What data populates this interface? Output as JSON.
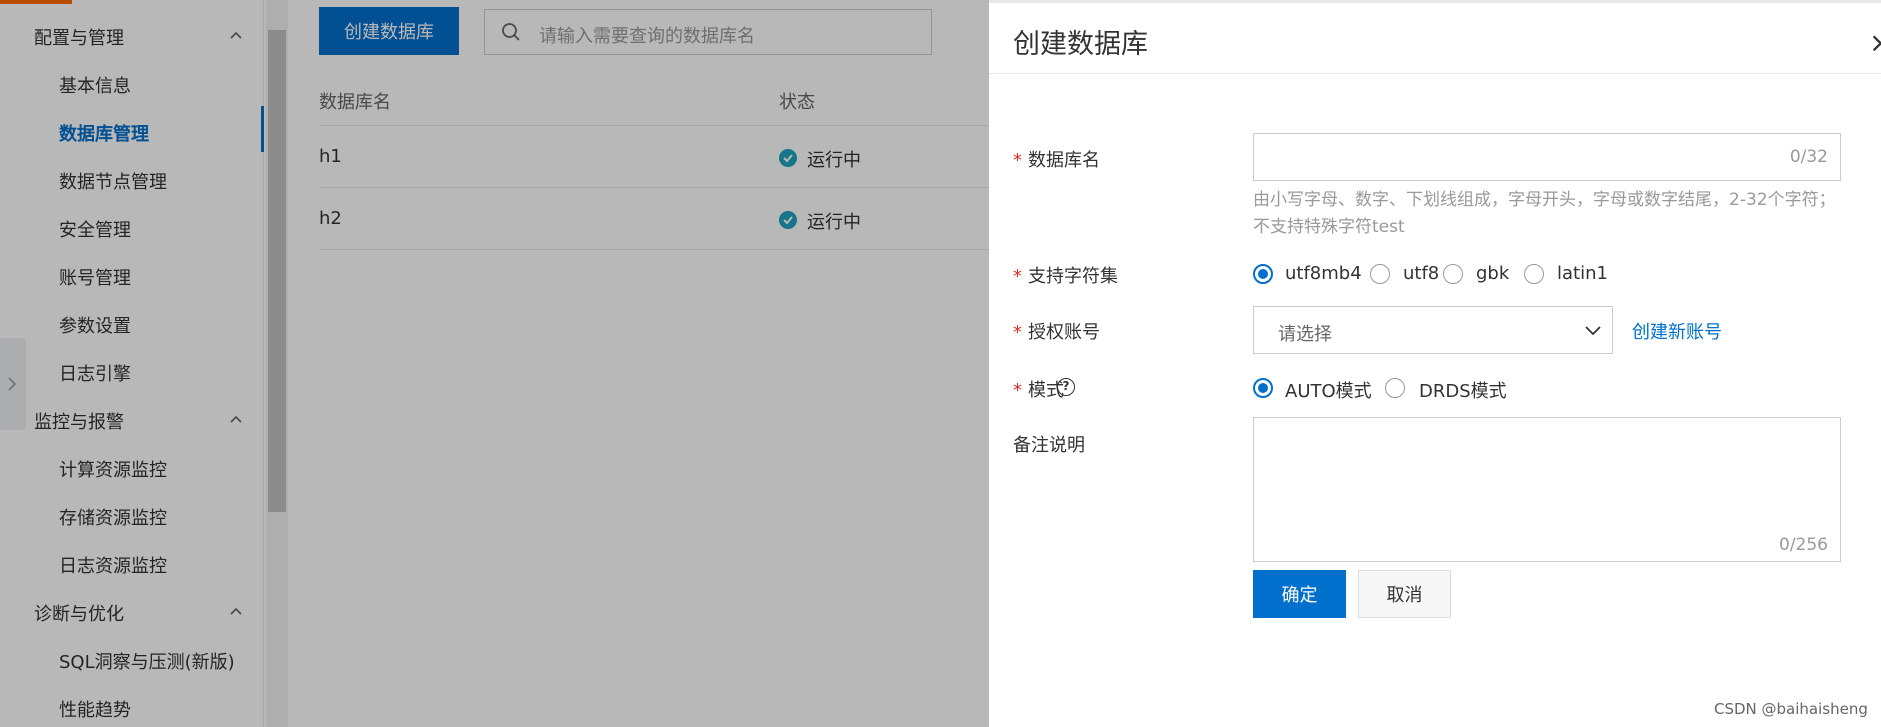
{
  "sidebar": {
    "groups": [
      {
        "label": "配置与管理"
      },
      {
        "label": "监控与报警"
      },
      {
        "label": "诊断与优化"
      }
    ],
    "items": [
      {
        "label": "基本信息"
      },
      {
        "label": "数据库管理"
      },
      {
        "label": "数据节点管理"
      },
      {
        "label": "安全管理"
      },
      {
        "label": "账号管理"
      },
      {
        "label": "参数设置"
      },
      {
        "label": "日志引擎"
      },
      {
        "label": "计算资源监控"
      },
      {
        "label": "存储资源监控"
      },
      {
        "label": "日志资源监控"
      },
      {
        "label": "SQL洞察与压测(新版)"
      },
      {
        "label": "性能趋势"
      }
    ]
  },
  "main": {
    "create_button": "创建数据库",
    "search_placeholder": "请输入需要查询的数据库名",
    "table": {
      "headers": [
        "数据库名",
        "状态"
      ],
      "rows": [
        {
          "name": "h1",
          "status": "运行中"
        },
        {
          "name": "h2",
          "status": "运行中"
        }
      ]
    }
  },
  "drawer": {
    "title": "创建数据库",
    "fields": {
      "db_name": {
        "label": "数据库名",
        "required": "*",
        "counter": "0/32",
        "hint": "由小写字母、数字、下划线组成，字母开头，字母或数字结尾，2-32个字符；不支持特殊字符test"
      },
      "charset": {
        "label": "支持字符集",
        "required": "*",
        "options": [
          "utf8mb4",
          "utf8",
          "gbk",
          "latin1"
        ],
        "selected": "utf8mb4"
      },
      "account": {
        "label": "授权账号",
        "required": "*",
        "placeholder": "请选择",
        "link": "创建新账号"
      },
      "mode": {
        "label": "模式",
        "required": "*",
        "options": [
          "AUTO模式",
          "DRDS模式"
        ],
        "selected": "AUTO模式"
      },
      "remark": {
        "label": "备注说明",
        "counter": "0/256"
      }
    },
    "ok_button": "确定",
    "cancel_button": "取消"
  },
  "watermark": "CSDN @baihaisheng",
  "colors": {
    "primary": "#0070cc",
    "required": "#d93026",
    "status_ok": "#1fa2bd"
  }
}
